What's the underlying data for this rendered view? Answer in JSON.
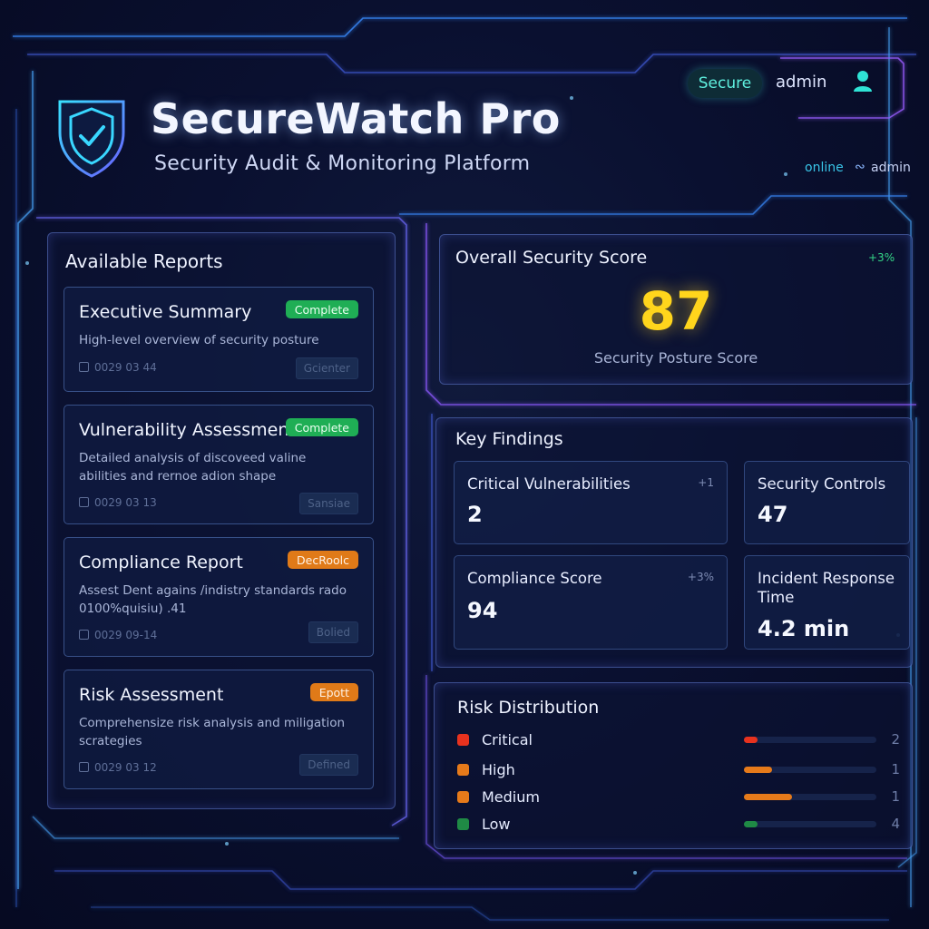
{
  "header": {
    "app_title": "SecureWatch Pro",
    "app_subtitle": "Security Audit & Monitoring Platform",
    "secure_badge": "Secure",
    "user_name": "admin",
    "status_online": "online",
    "status_user": "admin",
    "logo_icon": "shield-check-icon",
    "user_icon": "user-icon"
  },
  "reports": {
    "title": "Available Reports",
    "items": [
      {
        "title": "Executive Summary",
        "status": "Complete",
        "status_color": "#1fae55",
        "description": "High-level overview of security posture",
        "date": "0029 03 44",
        "action": "Gcienter"
      },
      {
        "title": "Vulnerability Assessment",
        "status": "Complete",
        "status_color": "#1fae55",
        "description": "Detailed analysis of discoveed valine abilities and rernoe adion shape",
        "date": "0029 03 13",
        "action": "Sansiae"
      },
      {
        "title": "Compliance Report",
        "status": "DecRoolc",
        "status_color": "#e07a18",
        "description": "Assest Dent agains /indistry standards rado 0100%quisiu) .41",
        "date": "0029 09-14",
        "action": "Bolied"
      },
      {
        "title": "Risk Assessment",
        "status": "Epott",
        "status_color": "#e07a18",
        "description": "Comprehensize risk analysis and miligation scrategies",
        "date": "0029 03 12",
        "action": "Defined"
      }
    ]
  },
  "score": {
    "title": "Overall Security Score",
    "trend": "+3%",
    "value": "87",
    "label": "Security Posture Score"
  },
  "findings": {
    "title": "Key Findings",
    "metrics": [
      {
        "label": "Critical Vulnerabilities",
        "value": "2",
        "trend": "+1"
      },
      {
        "label": "Security Controls",
        "value": "47",
        "trend": ""
      },
      {
        "label": "Compliance Score",
        "value": "94",
        "trend": "+3%"
      },
      {
        "label": "Incident Response Time",
        "value": "4.2 min",
        "trend": ""
      }
    ]
  },
  "risk": {
    "title": "Risk Distribution",
    "items": [
      {
        "name": "Critical",
        "count": "2",
        "color": "#e8321e",
        "level": 0.1
      },
      {
        "name": "High",
        "count": "1",
        "color": "#e67a1a",
        "level": 0.21
      },
      {
        "name": "Medium",
        "count": "1",
        "color": "#e67a1a",
        "level": 0.36
      },
      {
        "name": "Low",
        "count": "4",
        "color": "#1f8a45",
        "level": 0.1
      }
    ]
  }
}
